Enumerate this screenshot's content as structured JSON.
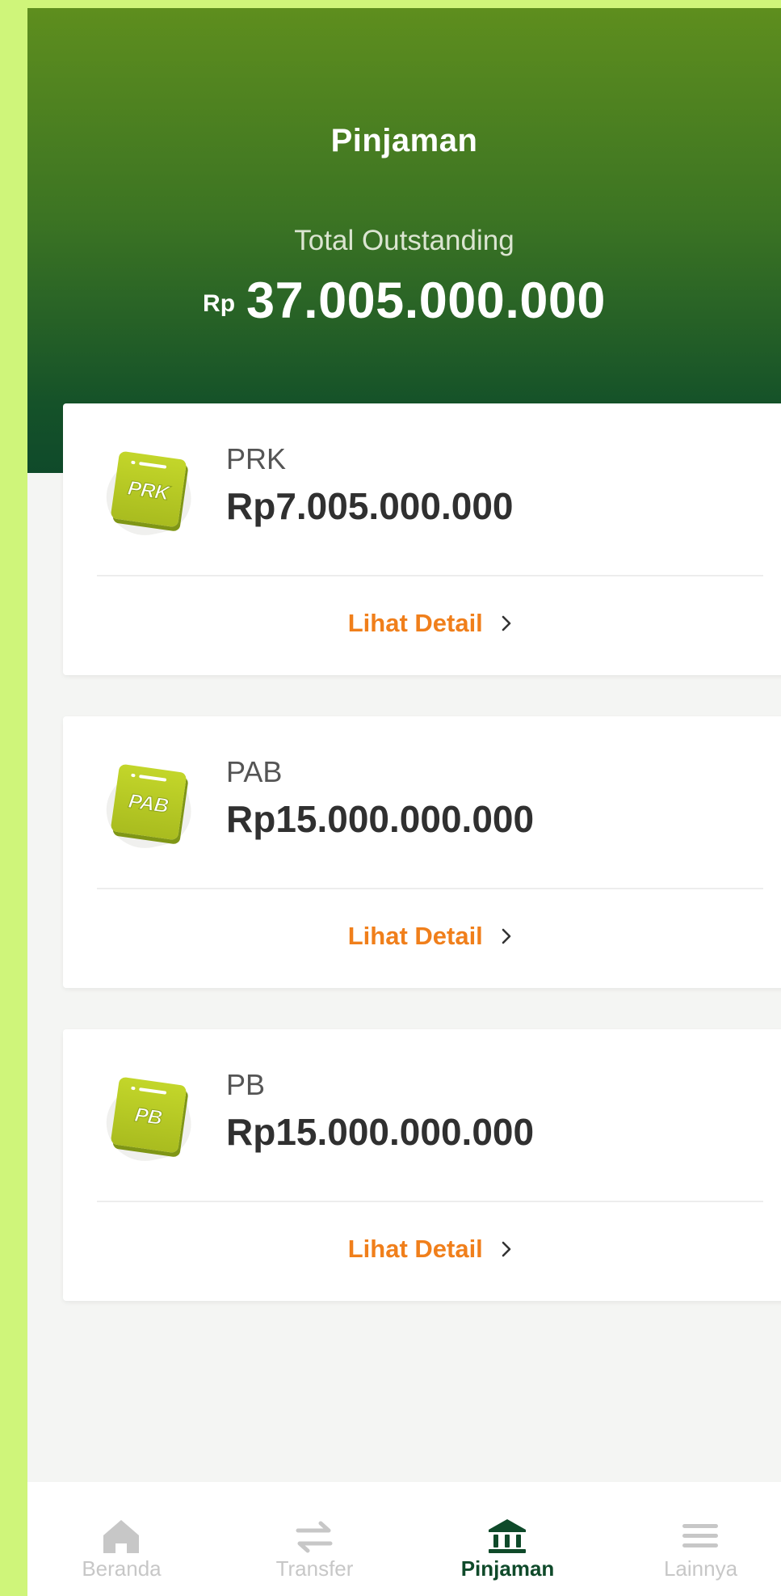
{
  "header": {
    "title": "Pinjaman",
    "total_label": "Total Outstanding",
    "currency": "Rp",
    "total_amount": "37.005.000.000"
  },
  "loans": [
    {
      "code": "PRK",
      "name": "PRK",
      "amount": "Rp7.005.000.000",
      "detail_label": "Lihat Detail"
    },
    {
      "code": "PAB",
      "name": "PAB",
      "amount": "Rp15.000.000.000",
      "detail_label": "Lihat Detail"
    },
    {
      "code": "PB",
      "name": "PB",
      "amount": "Rp15.000.000.000",
      "detail_label": "Lihat Detail"
    }
  ],
  "tabbar": {
    "items": [
      {
        "label": "Beranda",
        "icon": "home-icon",
        "active": false
      },
      {
        "label": "Transfer",
        "icon": "transfer-icon",
        "active": false
      },
      {
        "label": "Pinjaman",
        "icon": "bank-icon",
        "active": true
      },
      {
        "label": "Lainnya",
        "icon": "menu-icon",
        "active": false
      }
    ]
  },
  "colors": {
    "header_top": "#5e8e1e",
    "header_bottom": "#0f4a2a",
    "accent_orange": "#f07f1b",
    "icon_lime": "#b6ca24",
    "active_tab": "#0f4a2a",
    "inactive_tab": "#c7c7c7"
  }
}
